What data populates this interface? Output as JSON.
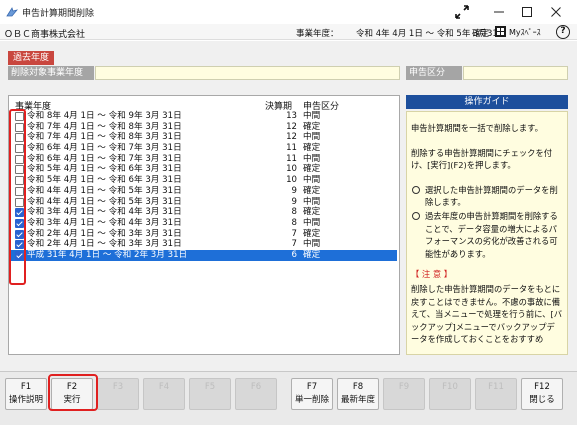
{
  "window": {
    "title": "申告計算期間削除"
  },
  "info": {
    "company": "ＯＢＣ商事株式会社",
    "fy_label": "事業年度：",
    "fy_value": "令和 4年 4月 1日 〜 令和 5年 3月31日",
    "confirm": "確定",
    "myspace": "Myｽﾍﾟｰｽ"
  },
  "form": {
    "past_tab": "過去年度",
    "target_label": "削除対象事業年度",
    "kind_label": "申告区分"
  },
  "list": {
    "headers": {
      "period": "事業年度",
      "num": "決算期",
      "kind": "申告区分"
    },
    "rows": [
      {
        "period": "令和  8年  4月  1日 〜 令和  9年  3月 31日",
        "num": "13",
        "kind": "中間",
        "checked": false,
        "selected": false
      },
      {
        "period": "令和  7年  4月  1日 〜 令和  8年  3月 31日",
        "num": "12",
        "kind": "確定",
        "checked": false,
        "selected": false
      },
      {
        "period": "令和  7年  4月  1日 〜 令和  8年  3月 31日",
        "num": "12",
        "kind": "中間",
        "checked": false,
        "selected": false
      },
      {
        "period": "令和  6年  4月  1日 〜 令和  7年  3月 31日",
        "num": "11",
        "kind": "確定",
        "checked": false,
        "selected": false
      },
      {
        "period": "令和  6年  4月  1日 〜 令和  7年  3月 31日",
        "num": "11",
        "kind": "中間",
        "checked": false,
        "selected": false
      },
      {
        "period": "令和  5年  4月  1日 〜 令和  6年  3月 31日",
        "num": "10",
        "kind": "確定",
        "checked": false,
        "selected": false
      },
      {
        "period": "令和  5年  4月  1日 〜 令和  6年  3月 31日",
        "num": "10",
        "kind": "中間",
        "checked": false,
        "selected": false
      },
      {
        "period": "令和  4年  4月  1日 〜 令和  5年  3月 31日",
        "num": "9",
        "kind": "確定",
        "checked": false,
        "selected": false
      },
      {
        "period": "令和  4年  4月  1日 〜 令和  5年  3月 31日",
        "num": "9",
        "kind": "中間",
        "checked": false,
        "selected": false
      },
      {
        "period": "令和  3年  4月  1日 〜 令和  4年  3月 31日",
        "num": "8",
        "kind": "確定",
        "checked": true,
        "selected": false
      },
      {
        "period": "令和  3年  4月  1日 〜 令和  4年  3月 31日",
        "num": "8",
        "kind": "中間",
        "checked": true,
        "selected": false
      },
      {
        "period": "令和  2年  4月  1日 〜 令和  3年  3月 31日",
        "num": "7",
        "kind": "確定",
        "checked": true,
        "selected": false
      },
      {
        "period": "令和  2年  4月  1日 〜 令和  3年  3月 31日",
        "num": "7",
        "kind": "中間",
        "checked": true,
        "selected": false
      },
      {
        "period": "平成 31年  4月  1日 〜 令和  2年  3月 31日",
        "num": "6",
        "kind": "確定",
        "checked": true,
        "selected": true
      }
    ]
  },
  "guide": {
    "title": "操作ガイド",
    "p1": "申告計算期間を一括で削除します。",
    "p2": "削除する申告計算期間にチェックを付け、[実行](F2)を押します。",
    "b1": "選択した申告計算期間のデータを削除します。",
    "b2": "過去年度の申告計算期間を削除することで、データ容量の増大によるパフォーマンスの劣化が改善される可能性があります。",
    "note_title": "【 注 意 】",
    "note": "削除した申告計算期間のデータをもとに戻すことはできません。不慮の事故に備えて、当メニューで処理を行う前に、[バックアップ]メニューでバックアップデータを作成しておくことをおすすめ"
  },
  "fkeys": [
    {
      "key": "F1",
      "label": "操作説明",
      "enabled": true
    },
    {
      "key": "F2",
      "label": "実行",
      "enabled": true
    },
    {
      "key": "F3",
      "label": "",
      "enabled": false
    },
    {
      "key": "F4",
      "label": "",
      "enabled": false
    },
    {
      "key": "F5",
      "label": "",
      "enabled": false
    },
    {
      "key": "F6",
      "label": "",
      "enabled": false
    },
    {
      "key": "F7",
      "label": "単一削除",
      "enabled": true
    },
    {
      "key": "F8",
      "label": "最新年度",
      "enabled": true
    },
    {
      "key": "F9",
      "label": "",
      "enabled": false
    },
    {
      "key": "F10",
      "label": "",
      "enabled": false
    },
    {
      "key": "F11",
      "label": "",
      "enabled": false
    },
    {
      "key": "F12",
      "label": "閉じる",
      "enabled": true
    }
  ],
  "colors": {
    "accent": "#1e6fd8",
    "guide_header": "#1d4f9c",
    "past_tab": "#c9473f",
    "highlight": "#e02020"
  },
  "icons": [
    "app-icon",
    "expand-icon",
    "minimize-icon",
    "maximize-icon",
    "close-icon",
    "myspace-icon",
    "help-icon",
    "checkbox-icon",
    "radio-bullet-icon"
  ]
}
